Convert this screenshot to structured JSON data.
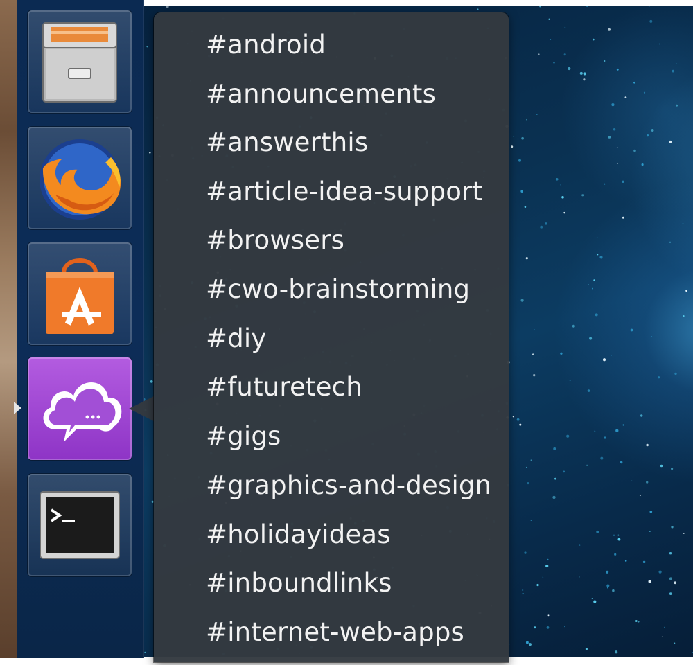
{
  "launcher": {
    "apps": [
      {
        "name": "Files",
        "icon": "file-cabinet-icon"
      },
      {
        "name": "Firefox Web Browser",
        "icon": "firefox-icon"
      },
      {
        "name": "Ubuntu Software Center",
        "icon": "software-center-icon"
      },
      {
        "name": "Chat Client",
        "icon": "chat-cloud-icon",
        "active": true
      },
      {
        "name": "Terminal",
        "icon": "terminal-icon"
      }
    ]
  },
  "quicklist": {
    "items": [
      "#android",
      "#announcements",
      "#answerthis",
      "#article-idea-support",
      "#browsers",
      "#cwo-brainstorming",
      "#diy",
      "#futuretech",
      "#gigs",
      "#graphics-and-design",
      "#holidayideas",
      "#inboundlinks",
      "#internet-web-apps"
    ]
  },
  "colors": {
    "launcher_bg": "#0d2d58",
    "active_tile": "#9c42d0",
    "menu_bg": "#343a40",
    "menu_text": "#f2f2f2",
    "desktop_bg": "#0a3152"
  }
}
